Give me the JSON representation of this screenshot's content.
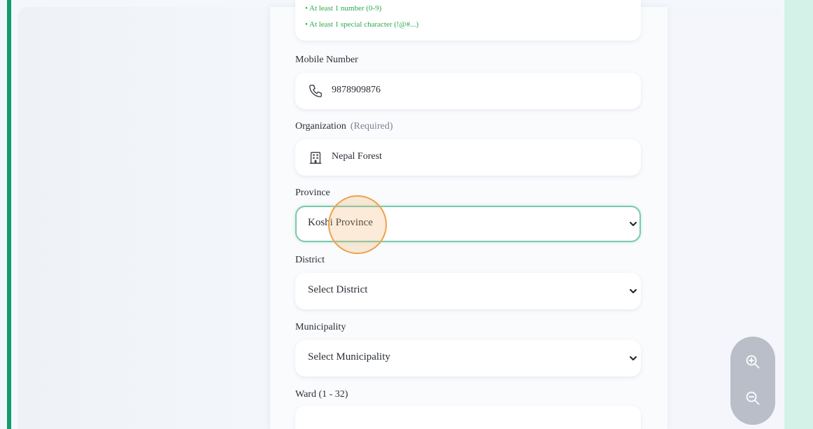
{
  "password_rules": [
    "• At least 1 number (0-9)",
    "• At least 1 special character (!@#...)"
  ],
  "mobile": {
    "label": "Mobile Number",
    "value": "9878909876",
    "icon": "phone-icon"
  },
  "organization": {
    "label": "Organization",
    "hint": "(Required)",
    "value": "Nepal Forest",
    "icon": "building-icon"
  },
  "province": {
    "label": "Province",
    "value": "Koshi Province"
  },
  "district": {
    "label": "District",
    "value": "Select District"
  },
  "municipality": {
    "label": "Municipality",
    "value": "Select Municipality"
  },
  "ward": {
    "label": "Ward (1 - 32)",
    "value": ""
  },
  "zoom": {
    "in_icon": "zoom-in-icon",
    "out_icon": "zoom-out-icon"
  },
  "colors": {
    "accent_green": "#119c6b",
    "rule_green": "#2ca84a",
    "focus_border": "#7cc9ad",
    "click_ring": "#f0a04a"
  }
}
